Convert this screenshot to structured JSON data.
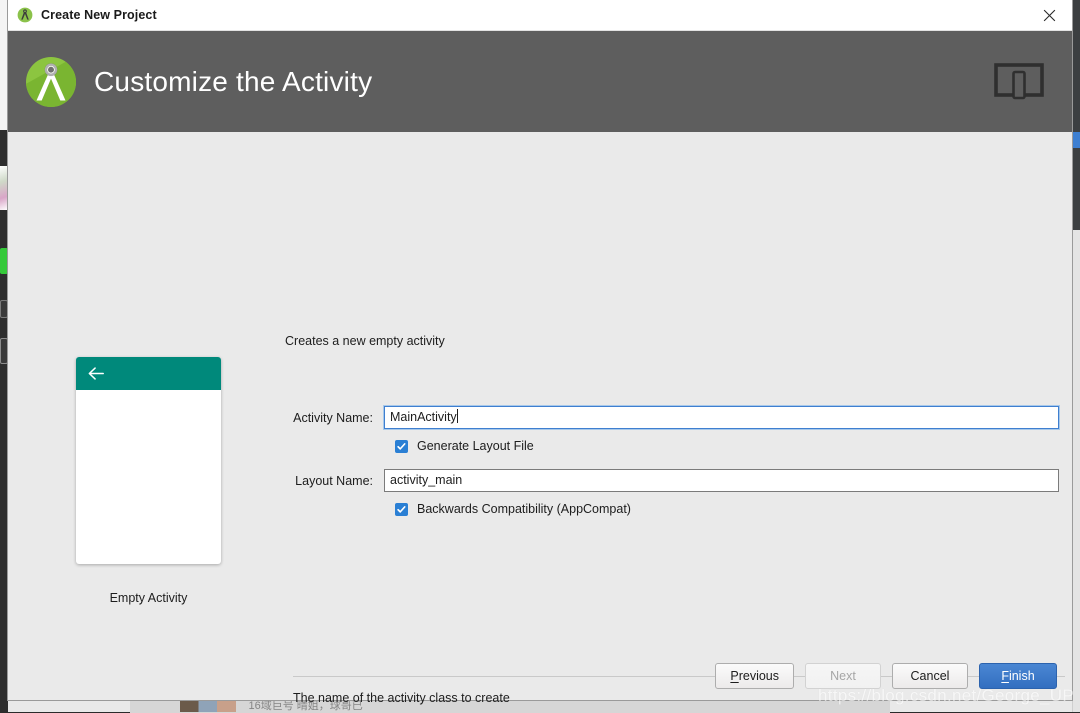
{
  "window": {
    "title": "Create New Project",
    "title_icon": "android-studio-icon",
    "close_icon": "close-icon"
  },
  "header": {
    "title": "Customize the Activity",
    "logo_icon": "android-studio-logo-icon",
    "device_icon": "device-preview-icon",
    "background_color": "#5e5e5e"
  },
  "body": {
    "description": "Creates a new empty activity",
    "help_text": "The name of the activity class to create"
  },
  "preview": {
    "label": "Empty Activity",
    "appbar_color": "#00897b",
    "back_icon": "back-arrow-icon"
  },
  "form": {
    "activity_name": {
      "label": "Activity Name:",
      "value": "MainActivity",
      "placeholder": "",
      "focused": true
    },
    "generate_layout": {
      "label": "Generate Layout File",
      "checked": true
    },
    "layout_name": {
      "label": "Layout Name:",
      "value": "activity_main",
      "placeholder": "",
      "focused": false
    },
    "backwards_compat": {
      "label": "Backwards Compatibility (AppCompat)",
      "checked": true
    },
    "checkbox_color": "#2a7fd4"
  },
  "buttons": {
    "previous": {
      "label": "Previous",
      "mnemonic": "P",
      "rest": "revious",
      "disabled": false
    },
    "next": {
      "label": "Next",
      "disabled": true
    },
    "cancel": {
      "label": "Cancel",
      "disabled": false
    },
    "finish": {
      "label": "Finish",
      "mnemonic": "F",
      "rest": "inish",
      "disabled": false,
      "primary": true,
      "color": "#3c74c2"
    }
  },
  "watermark": {
    "text": "https://blog.csdn.net/George_UP"
  },
  "background": {
    "bottom_window_title": "16域巨号 晴姐，球哥已"
  }
}
